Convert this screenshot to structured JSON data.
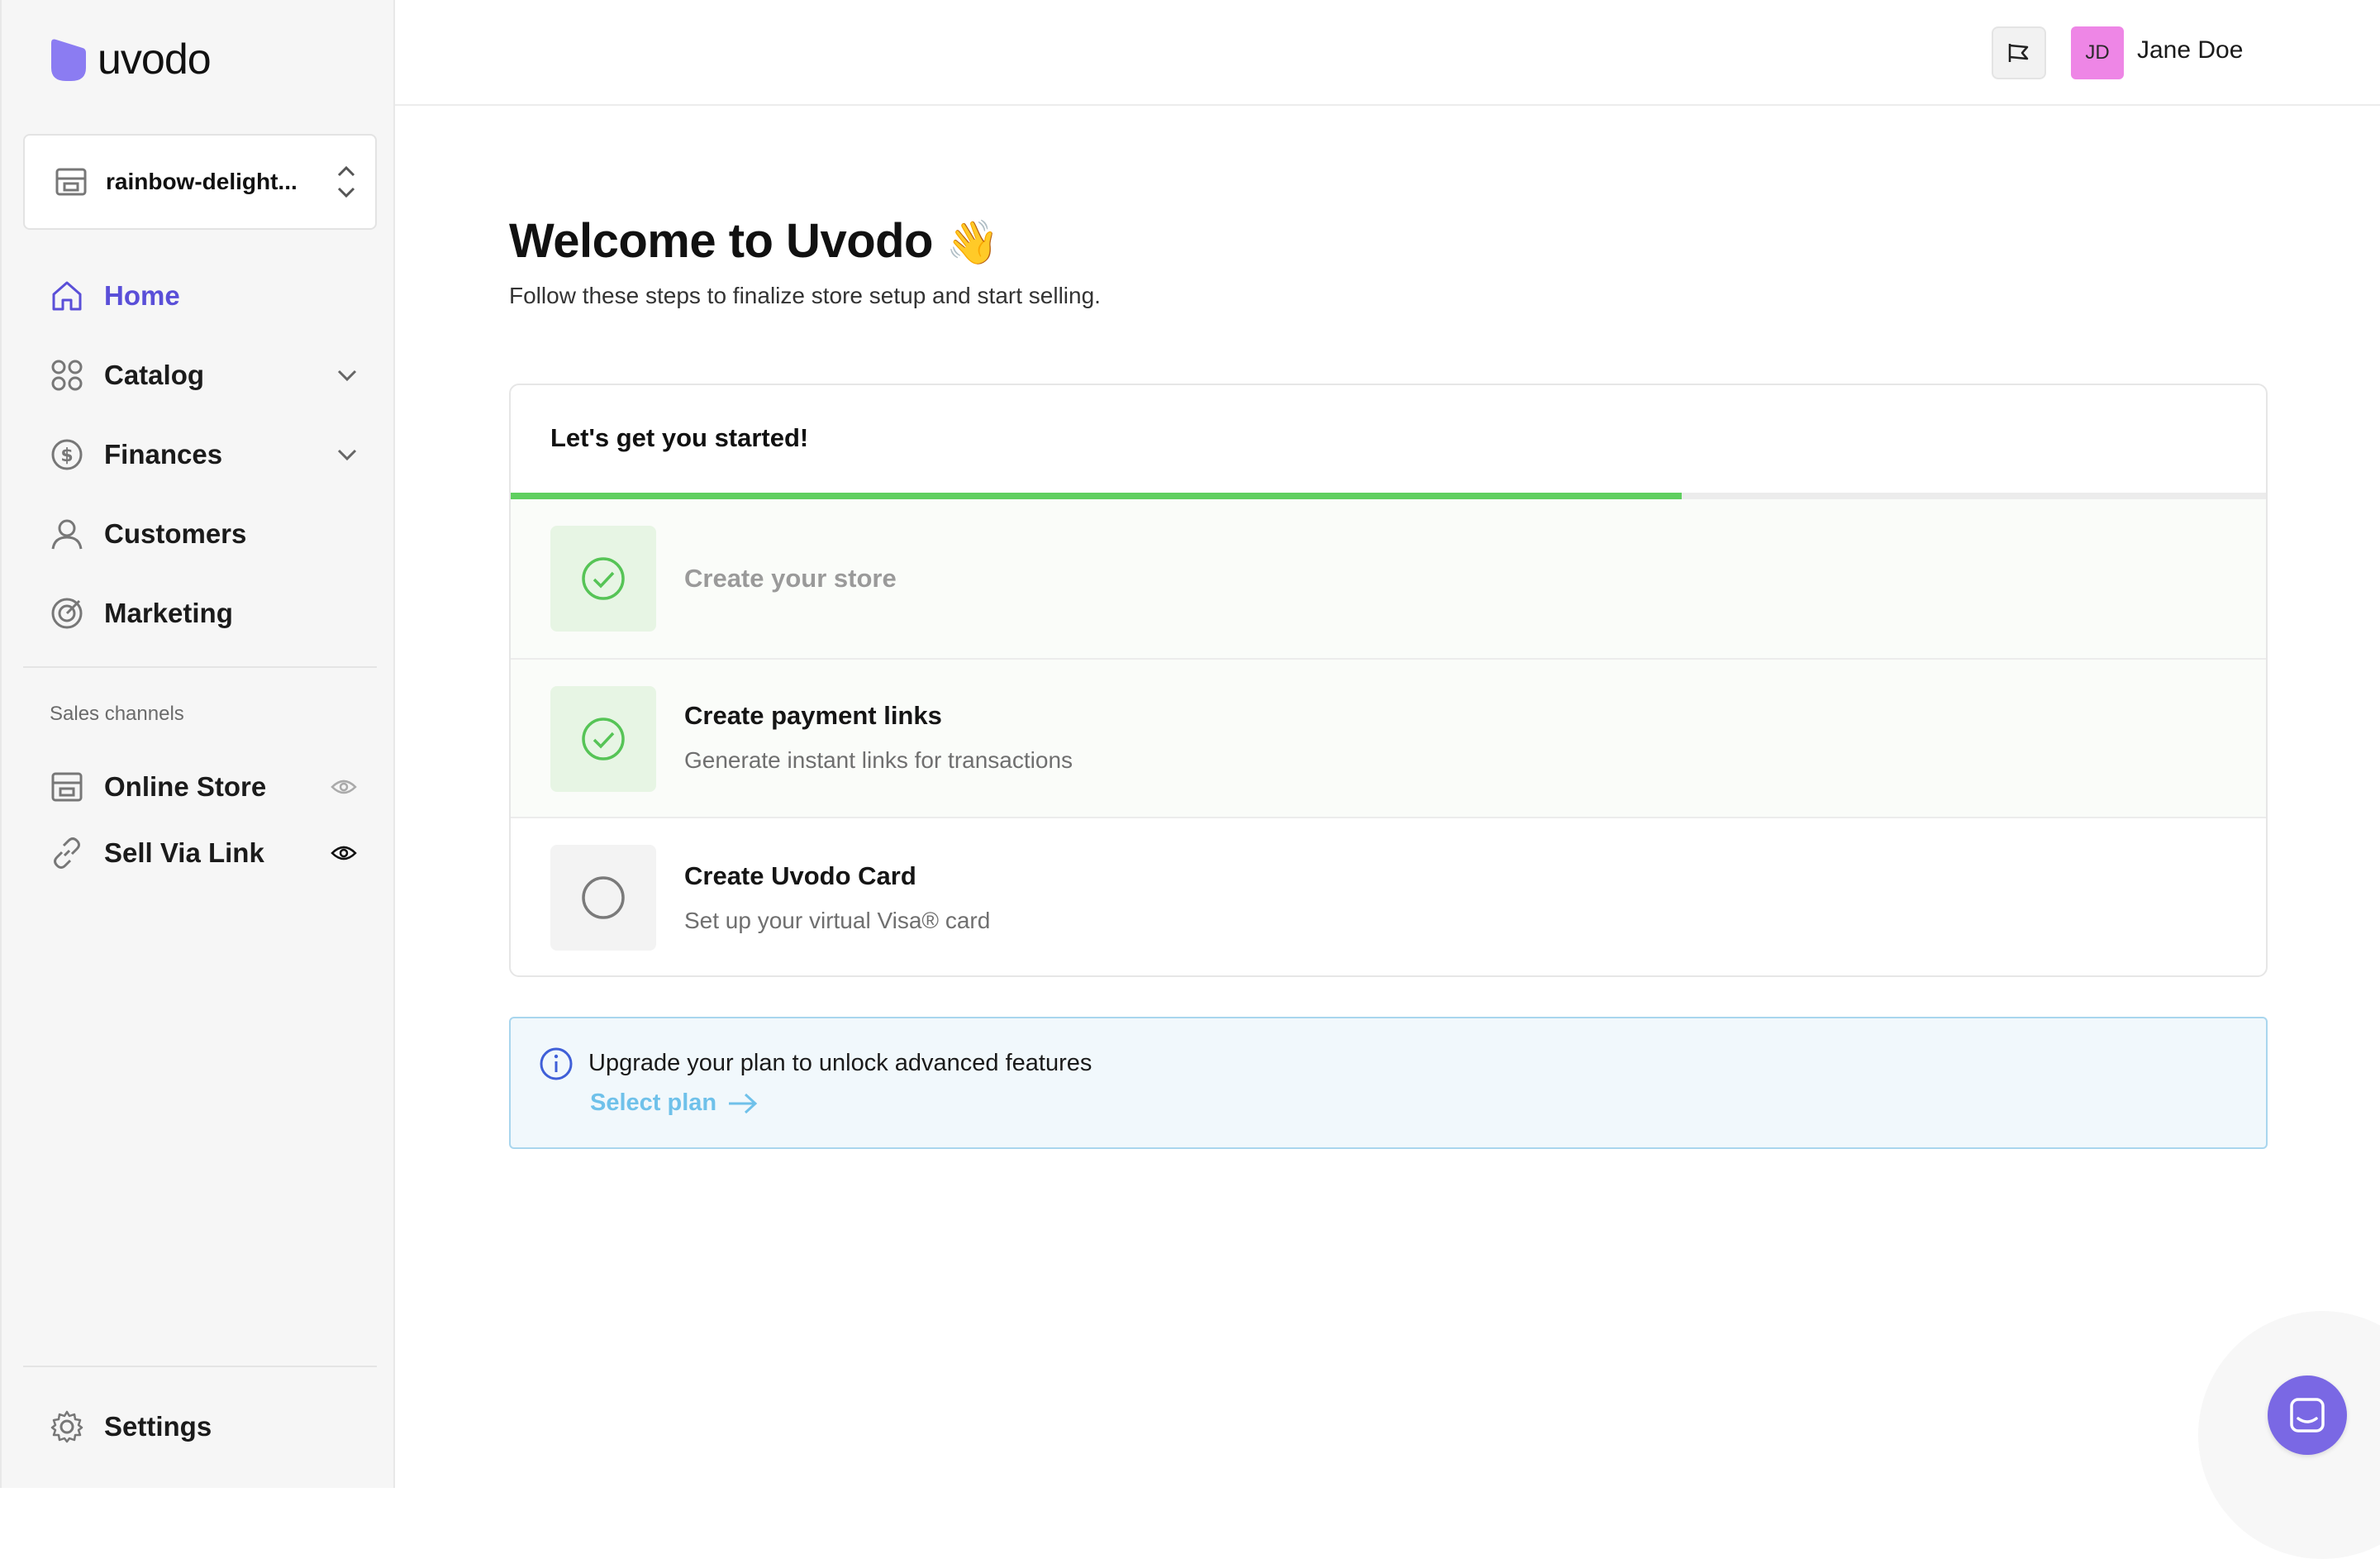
{
  "brand": {
    "name": "uvodo",
    "accent": "#5a4fd8",
    "logo_color": "#8b7cf2"
  },
  "store_switcher": {
    "store_name": "rainbow-delight..."
  },
  "nav": {
    "home": "Home",
    "catalog": "Catalog",
    "finances": "Finances",
    "customers": "Customers",
    "marketing": "Marketing"
  },
  "sales_channels": {
    "label": "Sales channels",
    "online_store": "Online Store",
    "sell_via_link": "Sell Via Link"
  },
  "settings": {
    "label": "Settings"
  },
  "header": {
    "user_initials": "JD",
    "user_name": "Jane Doe"
  },
  "main": {
    "title": "Welcome to Uvodo",
    "title_emoji": "👋",
    "subtitle": "Follow these steps to finalize store setup and start selling."
  },
  "onboarding": {
    "title": "Let's get you started!",
    "progress": 0.667,
    "steps": [
      {
        "title": "Create your store",
        "description": "",
        "status": "done"
      },
      {
        "title": "Create payment links",
        "description": "Generate instant links for transactions",
        "status": "done"
      },
      {
        "title": "Create Uvodo Card",
        "description": "Set up your virtual Visa® card",
        "status": "todo"
      }
    ]
  },
  "upgrade": {
    "text": "Upgrade your plan to unlock advanced features",
    "link": "Select plan"
  },
  "colors": {
    "success": "#5fcf5f",
    "info_border": "#a9d6ee",
    "avatar": "#ee86e6",
    "chat": "#7a68e4"
  }
}
